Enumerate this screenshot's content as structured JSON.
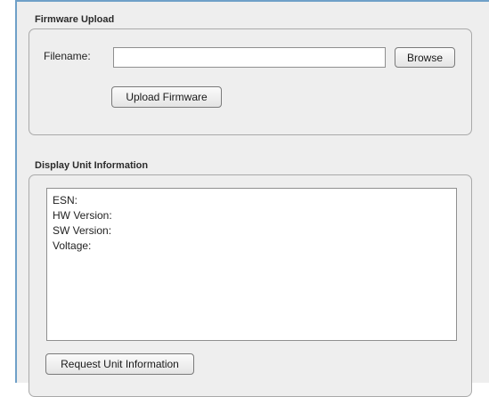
{
  "firmware_upload": {
    "title": "Firmware Upload",
    "filename_label": "Filename:",
    "filename_value": "",
    "browse_label": "Browse",
    "upload_label": "Upload Firmware"
  },
  "unit_info": {
    "title": "Display Unit Information",
    "lines": [
      "ESN:",
      "HW Version:",
      "SW Version:",
      "Voltage:"
    ],
    "request_label": "Request Unit Information"
  }
}
